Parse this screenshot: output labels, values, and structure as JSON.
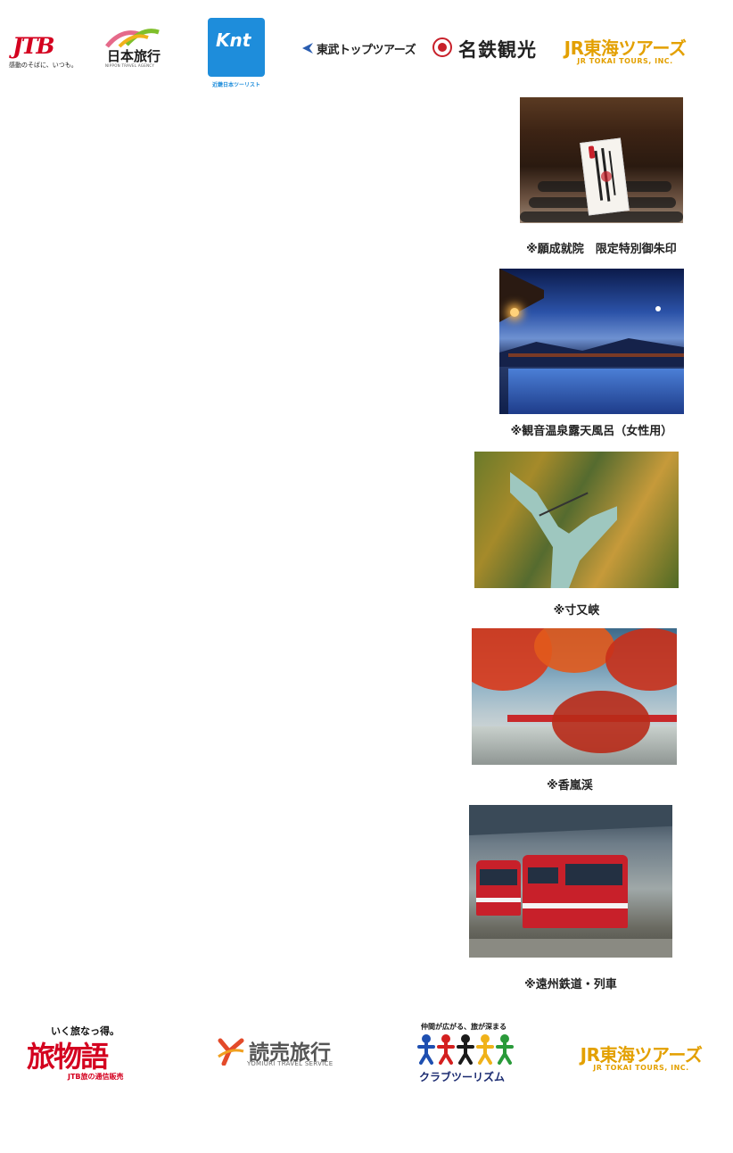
{
  "top_logos": {
    "jtb": {
      "name": "JTB",
      "tagline": "感動のそばに、いつも。"
    },
    "ntb": {
      "name": "日本旅行",
      "sub": "NIPPON TRAVEL AGENCY"
    },
    "knt": {
      "name": "Knt",
      "sub": "近畿日本ツーリスト"
    },
    "tobu": {
      "name": "東武トップツアーズ"
    },
    "meitetsu": {
      "name": "名鉄観光"
    },
    "jr_tokai": {
      "name": "JR東海ツアーズ",
      "sub": "JR TOKAI TOURS, INC."
    }
  },
  "gallery": [
    {
      "id": "ganjojuin",
      "caption": "※願成就院　限定特別御朱印"
    },
    {
      "id": "kannon-onsen",
      "caption": "※観音温泉露天風呂（女性用）"
    },
    {
      "id": "sumatakyo",
      "caption": "※寸又峡"
    },
    {
      "id": "korankei",
      "caption": "※香嵐渓"
    },
    {
      "id": "enshu-railway",
      "caption": "※遠州鉄道・列車"
    }
  ],
  "bottom_logos": {
    "tabimonogatari": {
      "tagline": "いく旅なっ得。",
      "name": "旅物語",
      "sub": "JTB旅の通信販売"
    },
    "yomiuri": {
      "name": "読売旅行",
      "sub": "YOMIURI TRAVEL SERVICE"
    },
    "club_tourism": {
      "tagline": "仲間が広がる、旅が深まる",
      "name": "クラブツーリズム"
    },
    "jr_tokai": {
      "name": "JR東海ツアーズ",
      "sub": "JR TOKAI TOURS, INC."
    }
  },
  "colors": {
    "jtb_red": "#d4001f",
    "knt_blue": "#1e8ddb",
    "jr_tokai_gold": "#e3a000",
    "caption_text": "#222222"
  }
}
